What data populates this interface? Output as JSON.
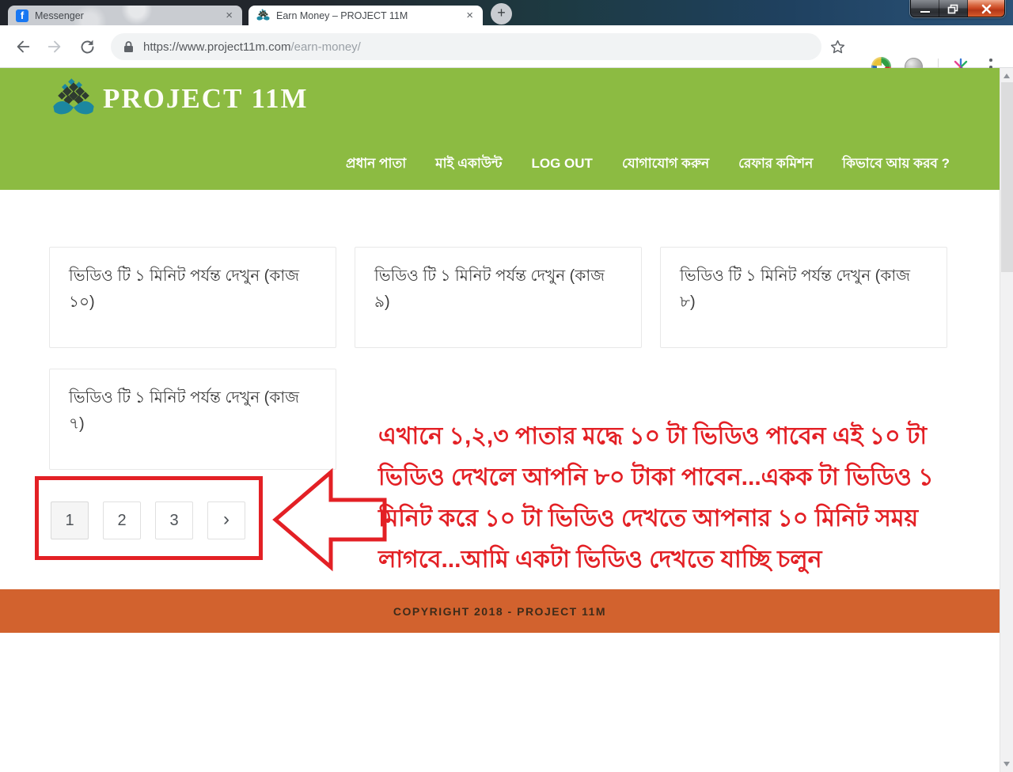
{
  "browser": {
    "tabs": [
      {
        "title": "Messenger",
        "close_glyph": "×"
      },
      {
        "title": "Earn Money – PROJECT 11M",
        "close_glyph": "×"
      }
    ],
    "new_tab_glyph": "+",
    "facebook_glyph": "f",
    "url": {
      "host": "https://www.project11m.com",
      "path": "/earn-money/"
    }
  },
  "site": {
    "logo_text": "PROJECT 11M",
    "nav": [
      {
        "label": "প্রধান পাতা"
      },
      {
        "label": "মাই একাউন্ট"
      },
      {
        "label": "LOG OUT"
      },
      {
        "label": "যোগাযোগ করুন"
      },
      {
        "label": "রেফার কমিশন"
      },
      {
        "label": "কিভাবে আয় করব ?"
      }
    ],
    "cards": [
      {
        "title": "ভিডিও টি ১ মিনিট পর্যন্ত দেখুন (কাজ ১০)"
      },
      {
        "title": "ভিডিও টি ১ মিনিট পর্যন্ত দেখুন (কাজ ৯)"
      },
      {
        "title": "ভিডিও টি ১ মিনিট পর্যন্ত দেখুন (কাজ ৮)"
      },
      {
        "title": "ভিডিও টি ১ মিনিট পর্যন্ত দেখুন (কাজ ৭)"
      }
    ],
    "pagination": {
      "p1": "1",
      "p2": "2",
      "p3": "3",
      "next": "›"
    },
    "annotation": {
      "lines": [
        "এখানে ১,২,৩ পাতার মদ্ধে ১০ টা ভিডিও পাবেন এই ১০ টা",
        "ভিডিও দেখলে আপনি ৮০ টাকা পাবেন...একক টা ভিডিও ১",
        "মিনিট করে ১০ টা ভিডিও দেখতে আপনার ১০ মিনিট সময়",
        "লাগবে...আমি একটা ভিডিও দেখতে যাচ্ছি চলুন"
      ]
    },
    "footer_text": "COPYRIGHT 2018 - PROJECT 11M"
  },
  "colors": {
    "header_green": "#8cbb42",
    "footer_orange": "#d2622e",
    "annotation_red": "#e32025",
    "close_button_red": "#c8431f",
    "hand_teal": "#1c87a0"
  }
}
